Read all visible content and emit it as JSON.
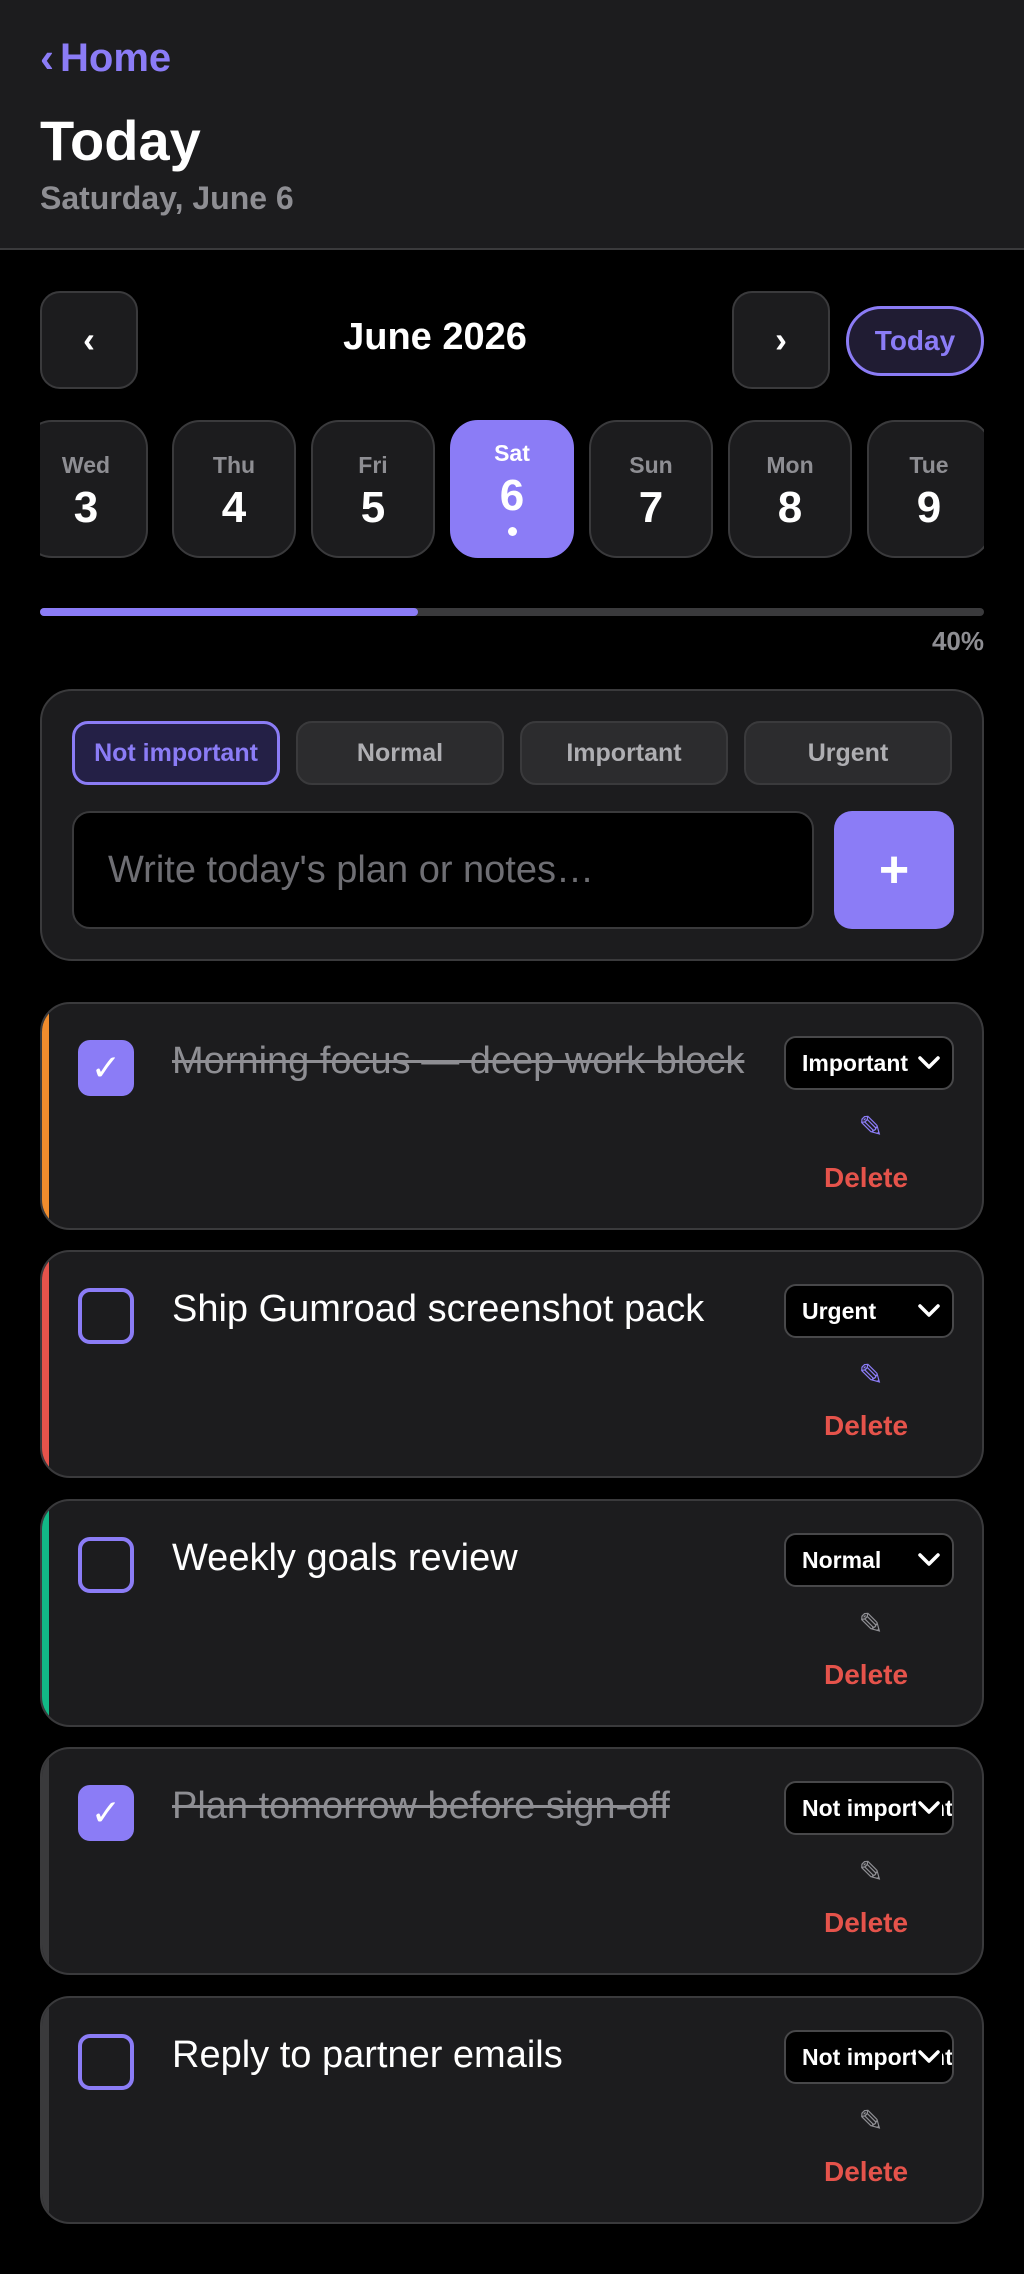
{
  "header": {
    "back_label": "Home",
    "title": "Today",
    "subtitle": "Saturday, June 6"
  },
  "calendar": {
    "prev_symbol": "‹",
    "next_symbol": "›",
    "month_label": "June 2026",
    "today_label": "Today",
    "days": [
      {
        "name": "Wed",
        "num": "3",
        "selected": false
      },
      {
        "name": "Thu",
        "num": "4",
        "selected": false
      },
      {
        "name": "Fri",
        "num": "5",
        "selected": false
      },
      {
        "name": "Sat",
        "num": "6",
        "selected": true
      },
      {
        "name": "Sun",
        "num": "7",
        "selected": false
      },
      {
        "name": "Mon",
        "num": "8",
        "selected": false
      },
      {
        "name": "Tue",
        "num": "9",
        "selected": false
      }
    ]
  },
  "progress": {
    "value": 0.4,
    "label": "40%"
  },
  "composer": {
    "priorities": [
      "Not important",
      "Normal",
      "Important",
      "Urgent"
    ],
    "active_priority": "Not important",
    "placeholder": "Write today's plan or notes…",
    "add_label": "+"
  },
  "tasks": [
    {
      "text": "Morning focus — deep work block",
      "done": true,
      "priority": "Important",
      "stripe_color": "#f08c2d"
    },
    {
      "text": "Ship Gumroad screenshot pack",
      "done": false,
      "priority": "Urgent",
      "stripe_color": "#e5534b"
    },
    {
      "text": "Weekly goals review",
      "done": false,
      "priority": "Normal",
      "stripe_color": "#12b886"
    },
    {
      "text": "Plan tomorrow before sign-off",
      "done": true,
      "priority": "Not important",
      "stripe_color": "#3a3a3c"
    },
    {
      "text": "Reply to partner emails",
      "done": false,
      "priority": "Not important",
      "stripe_color": "#3a3a3c"
    }
  ],
  "task_labels": {
    "delete_label": "Delete",
    "edit_icon": "pencil-icon",
    "check_mark": "✓"
  },
  "colors": {
    "accent": "#8b7cf6",
    "danger": "#e5534b",
    "surface": "#1c1c1e",
    "background": "#000000"
  }
}
